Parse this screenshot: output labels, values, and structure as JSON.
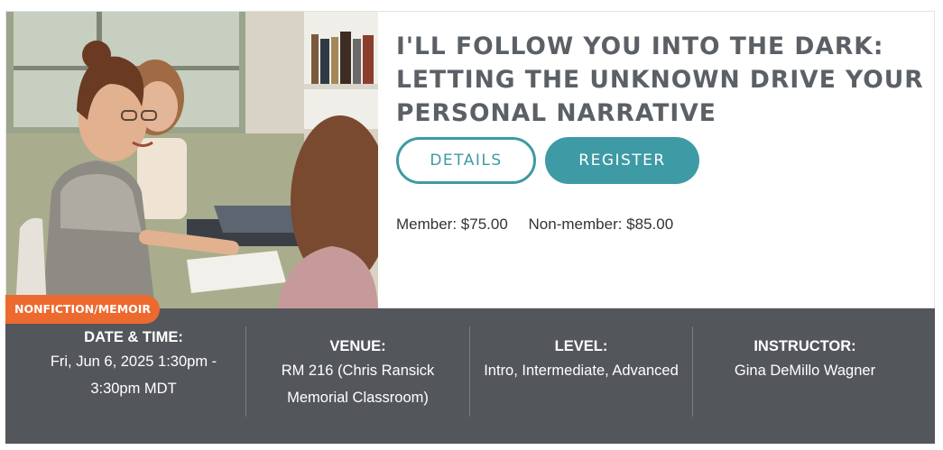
{
  "category_badge": "NONFICTION/MEMOIR",
  "title": "I'LL FOLLOW YOU INTO THE DARK: LETTING THE UNKNOWN DRIVE YOUR PERSONAL NARRATIVE",
  "buttons": {
    "details": "DETAILS",
    "register": "REGISTER"
  },
  "pricing": {
    "member": "Member: $75.00",
    "non_member": "Non-member: $85.00"
  },
  "info": {
    "date_label": "DATE & TIME:",
    "date_value": "Fri, Jun 6, 2025 1:30pm - 3:30pm MDT",
    "venue_label": "VENUE:",
    "venue_value": "RM 216 (Chris Ransick Memorial Classroom)",
    "level_label": "LEVEL:",
    "level_value": "Intro, Intermediate, Advanced",
    "instructor_label": "INSTRUCTOR:",
    "instructor_value": "Gina DeMillo Wagner"
  },
  "colors": {
    "accent": "#3e9aa4",
    "badge": "#ec6a2f",
    "info_bar": "#53565a",
    "title": "#5b6066"
  }
}
